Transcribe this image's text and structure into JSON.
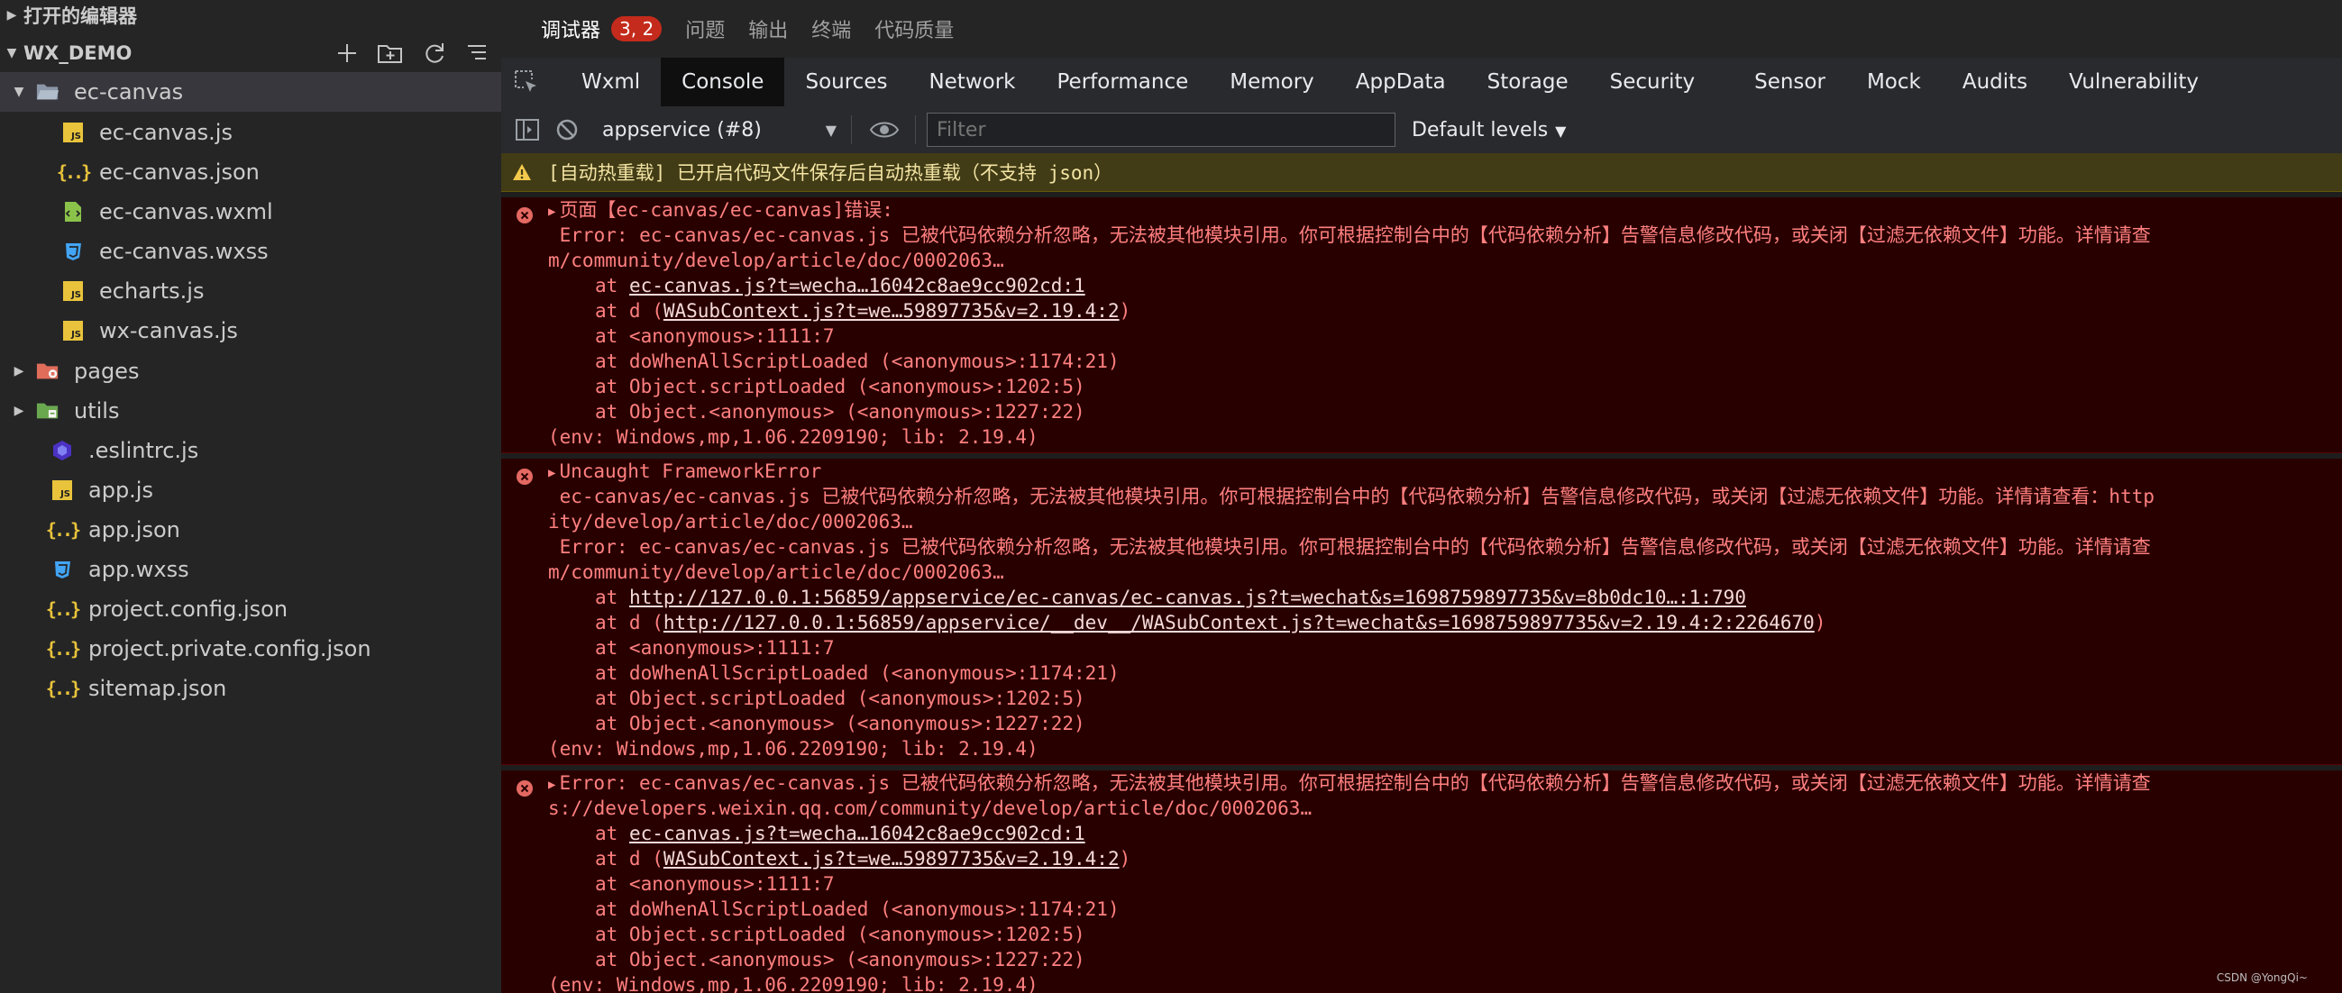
{
  "explorer": {
    "open_editors": "打开的编辑器",
    "project": "WX_DEMO",
    "items": [
      {
        "label": "ec-canvas",
        "kind": "folder-open"
      },
      {
        "label": "ec-canvas.js",
        "kind": "js"
      },
      {
        "label": "ec-canvas.json",
        "kind": "json"
      },
      {
        "label": "ec-canvas.wxml",
        "kind": "wxml"
      },
      {
        "label": "ec-canvas.wxss",
        "kind": "wxss"
      },
      {
        "label": "echarts.js",
        "kind": "js"
      },
      {
        "label": "wx-canvas.js",
        "kind": "js"
      },
      {
        "label": "pages",
        "kind": "folder-pages"
      },
      {
        "label": "utils",
        "kind": "folder-utils"
      },
      {
        "label": ".eslintrc.js",
        "kind": "eslint"
      },
      {
        "label": "app.js",
        "kind": "js"
      },
      {
        "label": "app.json",
        "kind": "json"
      },
      {
        "label": "app.wxss",
        "kind": "wxss"
      },
      {
        "label": "project.config.json",
        "kind": "json"
      },
      {
        "label": "project.private.config.json",
        "kind": "json"
      },
      {
        "label": "sitemap.json",
        "kind": "json"
      }
    ]
  },
  "panel_tabs": {
    "debugger": "调试器",
    "badge": "3, 2",
    "problems": "问题",
    "output": "输出",
    "terminal": "终端",
    "quality": "代码质量"
  },
  "devtools_tabs": [
    "Wxml",
    "Console",
    "Sources",
    "Network",
    "Performance",
    "Memory",
    "AppData",
    "Storage",
    "Security",
    "Sensor",
    "Mock",
    "Audits",
    "Vulnerability"
  ],
  "toolbar": {
    "context": "appservice (#8)",
    "filter_placeholder": "Filter",
    "levels": "Default levels"
  },
  "console": {
    "warning": "[自动热重载] 已开启代码文件保存后自动热重载（不支持 json）",
    "errors": [
      {
        "head": "页面【ec-canvas/ec-canvas]错误:",
        "lines": [
          " Error: ec-canvas/ec-canvas.js 已被代码依赖分析忽略，无法被其他模块引用。你可根据控制台中的【代码依赖分析】告警信息修改代码，或关闭【过滤无依赖文件】功能。详情请查",
          "m/community/develop/article/doc/0002063…"
        ],
        "stack": [
          {
            "pre": "at ",
            "link": "ec-canvas.js?t=wecha…16042c8ae9cc902cd:1",
            "post": ""
          },
          {
            "pre": "at d (",
            "link": "WASubContext.js?t=we…59897735&v=2.19.4:2",
            "post": ")"
          },
          {
            "pre": "at <anonymous>:1111:7",
            "link": "",
            "post": ""
          },
          {
            "pre": "at doWhenAllScriptLoaded (<anonymous>:1174:21)",
            "link": "",
            "post": ""
          },
          {
            "pre": "at Object.scriptLoaded (<anonymous>:1202:5)",
            "link": "",
            "post": ""
          },
          {
            "pre": "at Object.<anonymous> (<anonymous>:1227:22)",
            "link": "",
            "post": ""
          }
        ],
        "env": "(env: Windows,mp,1.06.2209190; lib: 2.19.4)"
      },
      {
        "head": "Uncaught FrameworkError",
        "lines": [
          " ec-canvas/ec-canvas.js 已被代码依赖分析忽略，无法被其他模块引用。你可根据控制台中的【代码依赖分析】告警信息修改代码，或关闭【过滤无依赖文件】功能。详情请查看：http",
          "ity/develop/article/doc/0002063…",
          " Error: ec-canvas/ec-canvas.js 已被代码依赖分析忽略，无法被其他模块引用。你可根据控制台中的【代码依赖分析】告警信息修改代码，或关闭【过滤无依赖文件】功能。详情请查",
          "m/community/develop/article/doc/0002063…"
        ],
        "stack": [
          {
            "pre": "at ",
            "link": "http://127.0.0.1:56859/appservice/ec-canvas/ec-canvas.js?t=wechat&s=1698759897735&v=8b0dc10…:1:790",
            "post": ""
          },
          {
            "pre": "at d (",
            "link": "http://127.0.0.1:56859/appservice/__dev__/WASubContext.js?t=wechat&s=1698759897735&v=2.19.4:2:2264670",
            "post": ")"
          },
          {
            "pre": "at <anonymous>:1111:7",
            "link": "",
            "post": ""
          },
          {
            "pre": "at doWhenAllScriptLoaded (<anonymous>:1174:21)",
            "link": "",
            "post": ""
          },
          {
            "pre": "at Object.scriptLoaded (<anonymous>:1202:5)",
            "link": "",
            "post": ""
          },
          {
            "pre": "at Object.<anonymous> (<anonymous>:1227:22)",
            "link": "",
            "post": ""
          }
        ],
        "env": "(env: Windows,mp,1.06.2209190; lib: 2.19.4)"
      },
      {
        "head": "Error: ec-canvas/ec-canvas.js 已被代码依赖分析忽略，无法被其他模块引用。你可根据控制台中的【代码依赖分析】告警信息修改代码，或关闭【过滤无依赖文件】功能。详情请查",
        "lines": [
          "s://developers.weixin.qq.com/community/develop/article/doc/0002063…"
        ],
        "stack": [
          {
            "pre": "at ",
            "link": "ec-canvas.js?t=wecha…16042c8ae9cc902cd:1",
            "post": ""
          },
          {
            "pre": "at d (",
            "link": "WASubContext.js?t=we…59897735&v=2.19.4:2",
            "post": ")"
          },
          {
            "pre": "at <anonymous>:1111:7",
            "link": "",
            "post": ""
          },
          {
            "pre": "at doWhenAllScriptLoaded (<anonymous>:1174:21)",
            "link": "",
            "post": ""
          },
          {
            "pre": "at Object.scriptLoaded (<anonymous>:1202:5)",
            "link": "",
            "post": ""
          },
          {
            "pre": "at Object.<anonymous> (<anonymous>:1227:22)",
            "link": "",
            "post": ""
          }
        ],
        "env": "(env: Windows,mp,1.06.2209190; lib: 2.19.4)"
      }
    ]
  },
  "watermark": "CSDN @YongQi~",
  "colors": {
    "sidebar_bg": "#252526",
    "error_bg": "#290000",
    "error_text": "#ff8080",
    "warn_bg": "#413b16",
    "badge": "#c42b1c",
    "js_icon": "#e8c33b",
    "wxss_icon": "#42a5f5",
    "wxml_icon": "#8bc34a"
  }
}
